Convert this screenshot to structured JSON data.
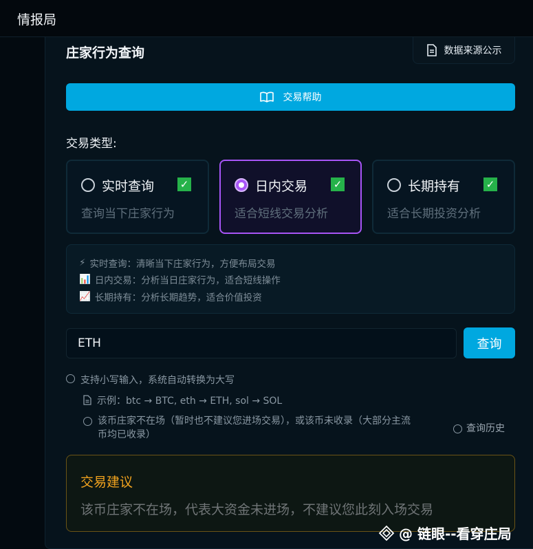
{
  "app": {
    "title": "情报局"
  },
  "page": {
    "title": "庄家行为查询",
    "source_button": "数据来源公示",
    "help_button": "交易帮助"
  },
  "trade_type": {
    "label": "交易类型:",
    "options": [
      {
        "title": "实时查询",
        "desc": "查询当下庄家行为",
        "selected": false
      },
      {
        "title": "日内交易",
        "desc": "适合短线交易分析",
        "selected": true
      },
      {
        "title": "长期持有",
        "desc": "适合长期投资分析",
        "selected": false
      }
    ]
  },
  "info": {
    "lines": [
      {
        "icon": "⚡",
        "text": "实时查询：清晰当下庄家行为，方便布局交易"
      },
      {
        "icon": "📊",
        "text": "日内交易：分析当日庄家行为，适合短线操作"
      },
      {
        "icon": "📈",
        "text": "长期持有：分析长期趋势，适合价值投资"
      }
    ]
  },
  "search": {
    "value": "ETH",
    "button": "查询"
  },
  "hints": {
    "lowercase": "支持小写输入，系统自动转换为大写",
    "example": "示例：btc → BTC, eth → ETH, sol → SOL",
    "status_line1": "该币庄家不在场（暂时也不建议您进场交易），或该币未收录（大部分主流",
    "status_line2": "币均已收录）",
    "history": "查询历史"
  },
  "advice": {
    "title": "交易建议",
    "text": "该币庄家不在场，代表大资金未进场，不建议您此刻入场交易"
  },
  "watermark": "@ 链眼--看穿庄局",
  "colors": {
    "accent": "#00a8e0",
    "selected": "#a855f7",
    "warning": "#f0a21e",
    "check": "#26b24a"
  }
}
